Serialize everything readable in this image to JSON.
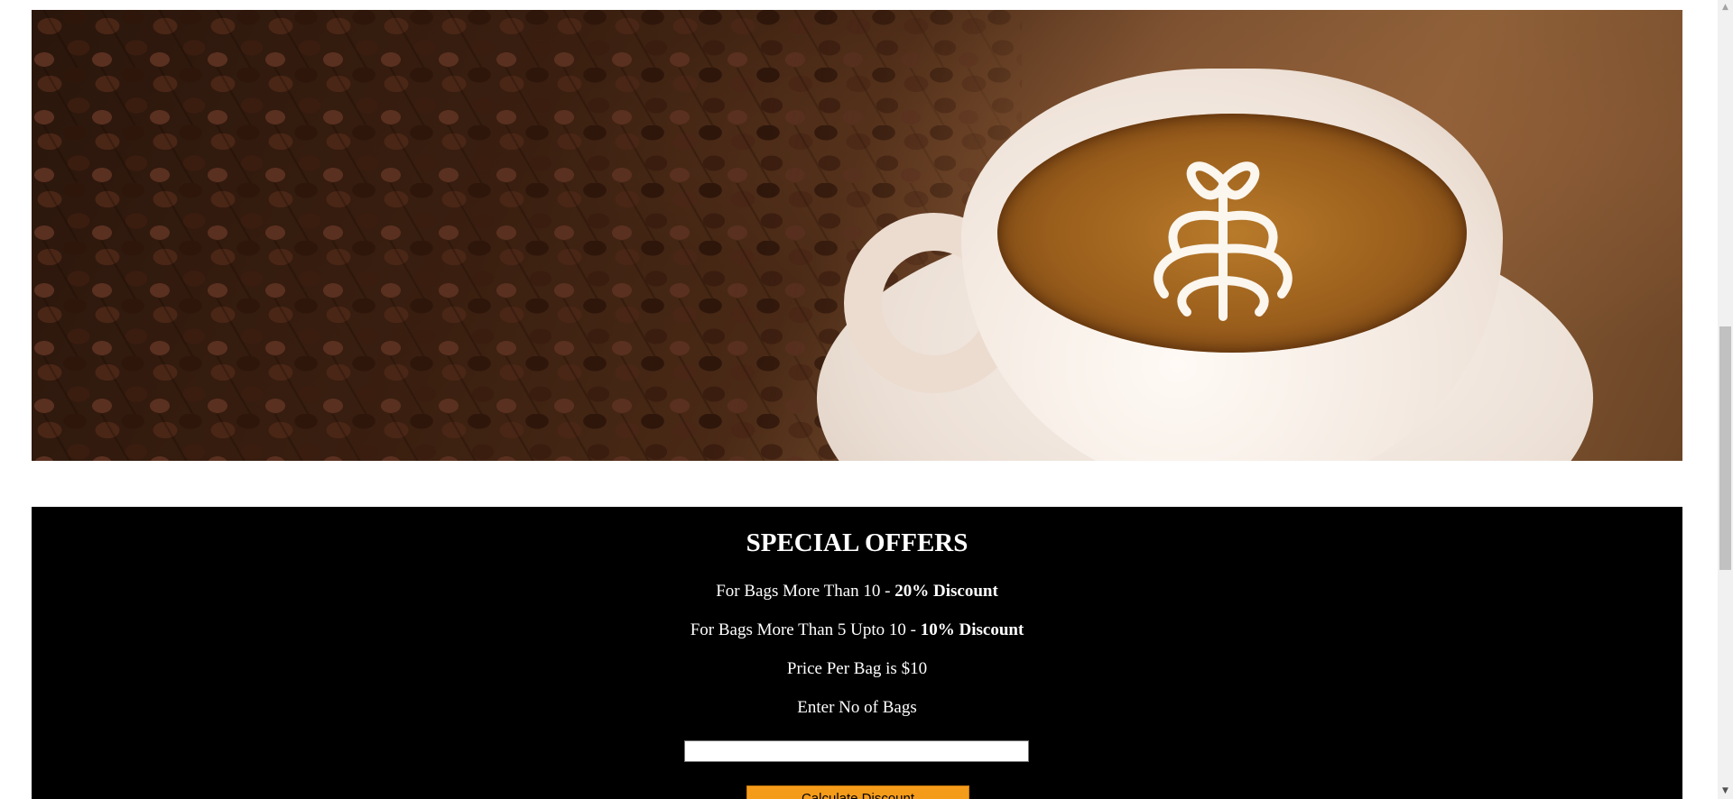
{
  "hero": {
    "image_description": "coffee-cup-with-beans-image"
  },
  "offers": {
    "title": "SPECIAL OFFERS",
    "line1_text": "For Bags More Than 10 - ",
    "line1_bold": "20% Discount",
    "line2_text": "For Bags More Than 5 Upto 10 - ",
    "line2_bold": "10% Discount",
    "line3": "Price Per Bag is $10",
    "line4": "Enter No of Bags",
    "input_value": "",
    "button_label": "Calculate Discount",
    "background_color": "#000000",
    "button_color": "#f59b1a"
  },
  "scrollbar": {
    "up_icon": "arrow-up-icon",
    "down_icon": "arrow-down-icon"
  }
}
